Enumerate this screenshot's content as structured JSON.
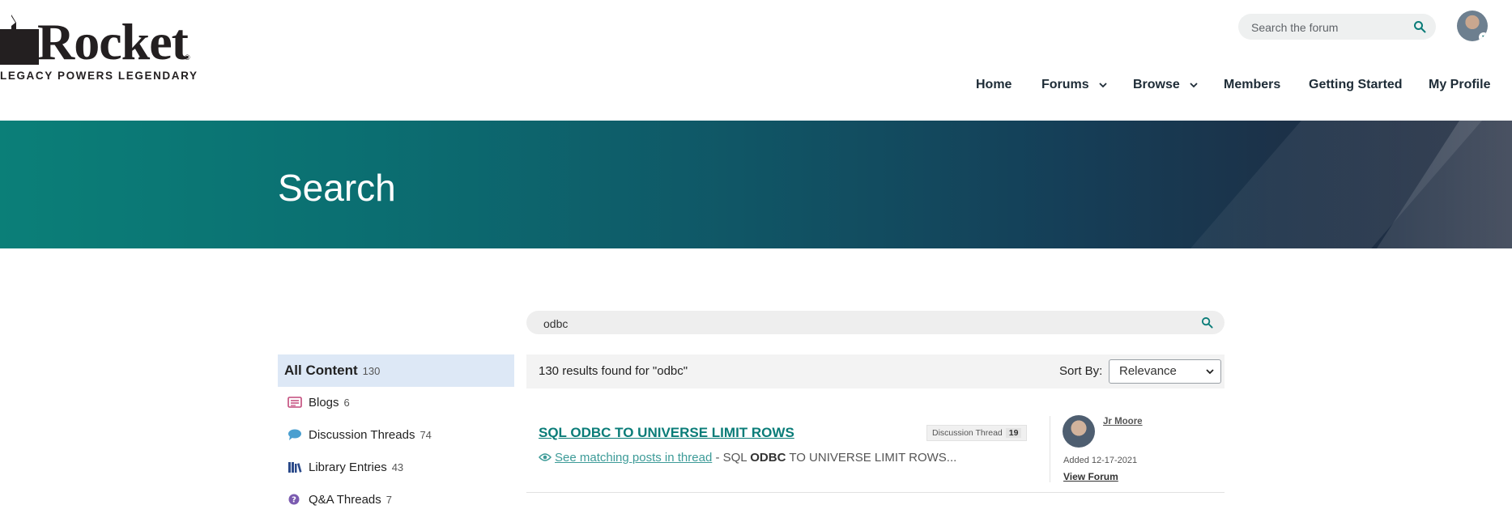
{
  "brand": {
    "name": "Rocket",
    "tagline": "LEGACY POWERS LEGENDARY",
    "registered_mark": "®",
    "accent_color": "#0a7c78",
    "hero_gradient": [
      "#0b7f78",
      "#222c40"
    ]
  },
  "header": {
    "search": {
      "placeholder": "Search the forum",
      "icon": "search-icon"
    },
    "avatar_icon": "user-avatar",
    "nav": [
      {
        "label": "Home"
      },
      {
        "label": "Forums",
        "dropdown": true
      },
      {
        "label": "Browse",
        "dropdown": true
      },
      {
        "label": "Members"
      },
      {
        "label": "Getting Started"
      },
      {
        "label": "My Profile"
      }
    ]
  },
  "hero": {
    "title": "Search"
  },
  "main_search": {
    "value": "odbc",
    "icon": "search-icon"
  },
  "sidebar": {
    "items": [
      {
        "label": "All Content",
        "count": "130",
        "active": true
      },
      {
        "label": "Blogs",
        "count": "6",
        "icon": "blog-icon",
        "color": "#c2497a"
      },
      {
        "label": "Discussion Threads",
        "count": "74",
        "icon": "chat-bubble-icon",
        "color": "#4a9fd0"
      },
      {
        "label": "Library Entries",
        "count": "43",
        "icon": "library-books-icon",
        "color": "#2b4a8a"
      },
      {
        "label": "Q&A Threads",
        "count": "7",
        "icon": "question-icon",
        "color": "#7b5bb0"
      }
    ]
  },
  "results": {
    "summary": "130 results found for \"odbc\"",
    "sort_label": "Sort By:",
    "sort_value": "Relevance",
    "items": [
      {
        "title": "SQL ODBC TO UNIVERSE LIMIT ROWS",
        "type_label": "Discussion Thread",
        "type_count": "19",
        "match_link": "See matching posts in thread",
        "snippet_prefix": " - SQL ",
        "snippet_bold": "ODBC",
        "snippet_suffix": " TO UNIVERSE LIMIT ROWS...",
        "author": "Jr Moore",
        "added": "Added 12-17-2021",
        "view_forum": "View Forum"
      }
    ]
  }
}
